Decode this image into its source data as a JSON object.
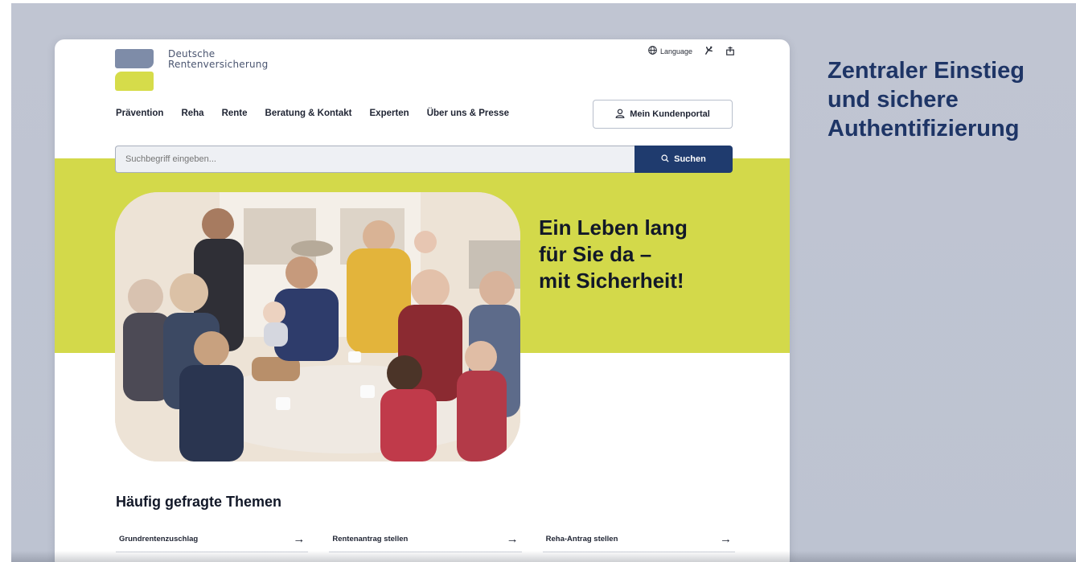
{
  "brand": {
    "line1": "Deutsche",
    "line2": "Rentenversicherung",
    "colors": {
      "top": "#7e8ca8",
      "bottom": "#d6dc4a",
      "navy": "#1f3b6e",
      "lime": "#d3d94a"
    }
  },
  "utility": {
    "language_label": "Language",
    "language_icon": "globe-icon",
    "sign_language_icon": "sign-language-icon",
    "simple_language_icon": "easy-language-icon"
  },
  "nav": {
    "items": [
      {
        "label": "Prävention"
      },
      {
        "label": "Reha"
      },
      {
        "label": "Rente"
      },
      {
        "label": "Beratung & Kontakt"
      },
      {
        "label": "Experten"
      },
      {
        "label": "Über uns & Presse"
      }
    ],
    "portal_label": "Mein Kundenportal",
    "portal_icon": "user-icon"
  },
  "search": {
    "placeholder": "Suchbegriff eingeben...",
    "button_label": "Suchen",
    "button_icon": "search-icon"
  },
  "hero": {
    "title": "Ein Leben lang\nfür Sie da –\nmit Sicherheit!"
  },
  "faq": {
    "title": "Häufig gefragte Themen",
    "links": [
      {
        "label": "Grundrentenzuschlag"
      },
      {
        "label": "Rentenantrag stellen"
      },
      {
        "label": "Reha-Antrag stellen"
      }
    ]
  },
  "caption": "Zentraler Einstieg\nund sichere\nAuthentifizierung"
}
